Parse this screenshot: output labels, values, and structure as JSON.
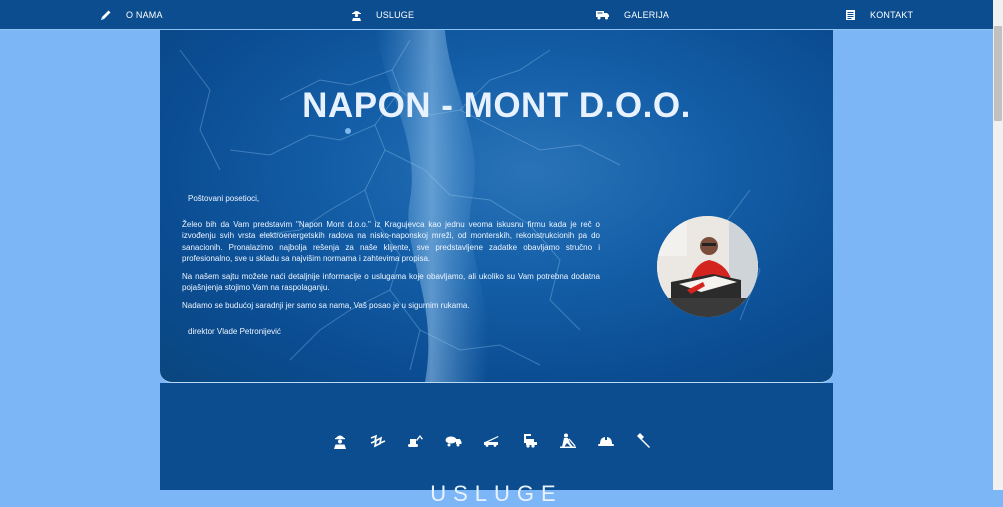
{
  "nav": {
    "items": [
      {
        "label": "O NAMA",
        "icon": "pencil-icon"
      },
      {
        "label": "USLUGE",
        "icon": "worker-icon"
      },
      {
        "label": "GALERIJA",
        "icon": "truck-icon"
      },
      {
        "label": "KONTAKT",
        "icon": "document-icon"
      }
    ]
  },
  "hero": {
    "title": "NAPON - MONT D.O.O.",
    "greeting": "Poštovani posetioci,",
    "paragraphs": [
      "Želeo bih da Vam predstavim \"Napon Mont d.o.o.\" iz Kragujevca kao jednu veoma iskusnu firmu kada je reč o izvođenju svih vrsta elektroenergetskih radova na nisko-naponskoj mreži, od monterskih, rekonstrukcionih pa do sanacionih. Pronalazimo najbolja rešenja za naše klijente, sve predstavljene zadatke obavljamo stručno i profesionalno, sve u skladu sa najvišim normama i zahtevima propisa.",
      "Na našem sajtu možete naći detaljnije informacije o uslugama koje obavljamo, ali ukoliko su Vam potrebna dodatna pojašnjenja stojimo Vam na raspolaganju.",
      "Nadamo se budućoj saradnji jer samo sa nama, Vaš posao je u sigurnim rukama."
    ],
    "signature": "direktor Vlade Petronijević"
  },
  "services": {
    "heading": "USLUGE",
    "icons": [
      "worker-icon",
      "power-line-icon",
      "excavator-icon",
      "concrete-mixer-icon",
      "crane-truck-icon",
      "loader-icon",
      "digging-worker-icon",
      "hard-hat-icon",
      "hammer-icon"
    ]
  },
  "colors": {
    "page_background": "#7db6f7",
    "nav_background": "#0b4d8e",
    "hero_background": "#145fa8",
    "text": "#ffffff"
  }
}
